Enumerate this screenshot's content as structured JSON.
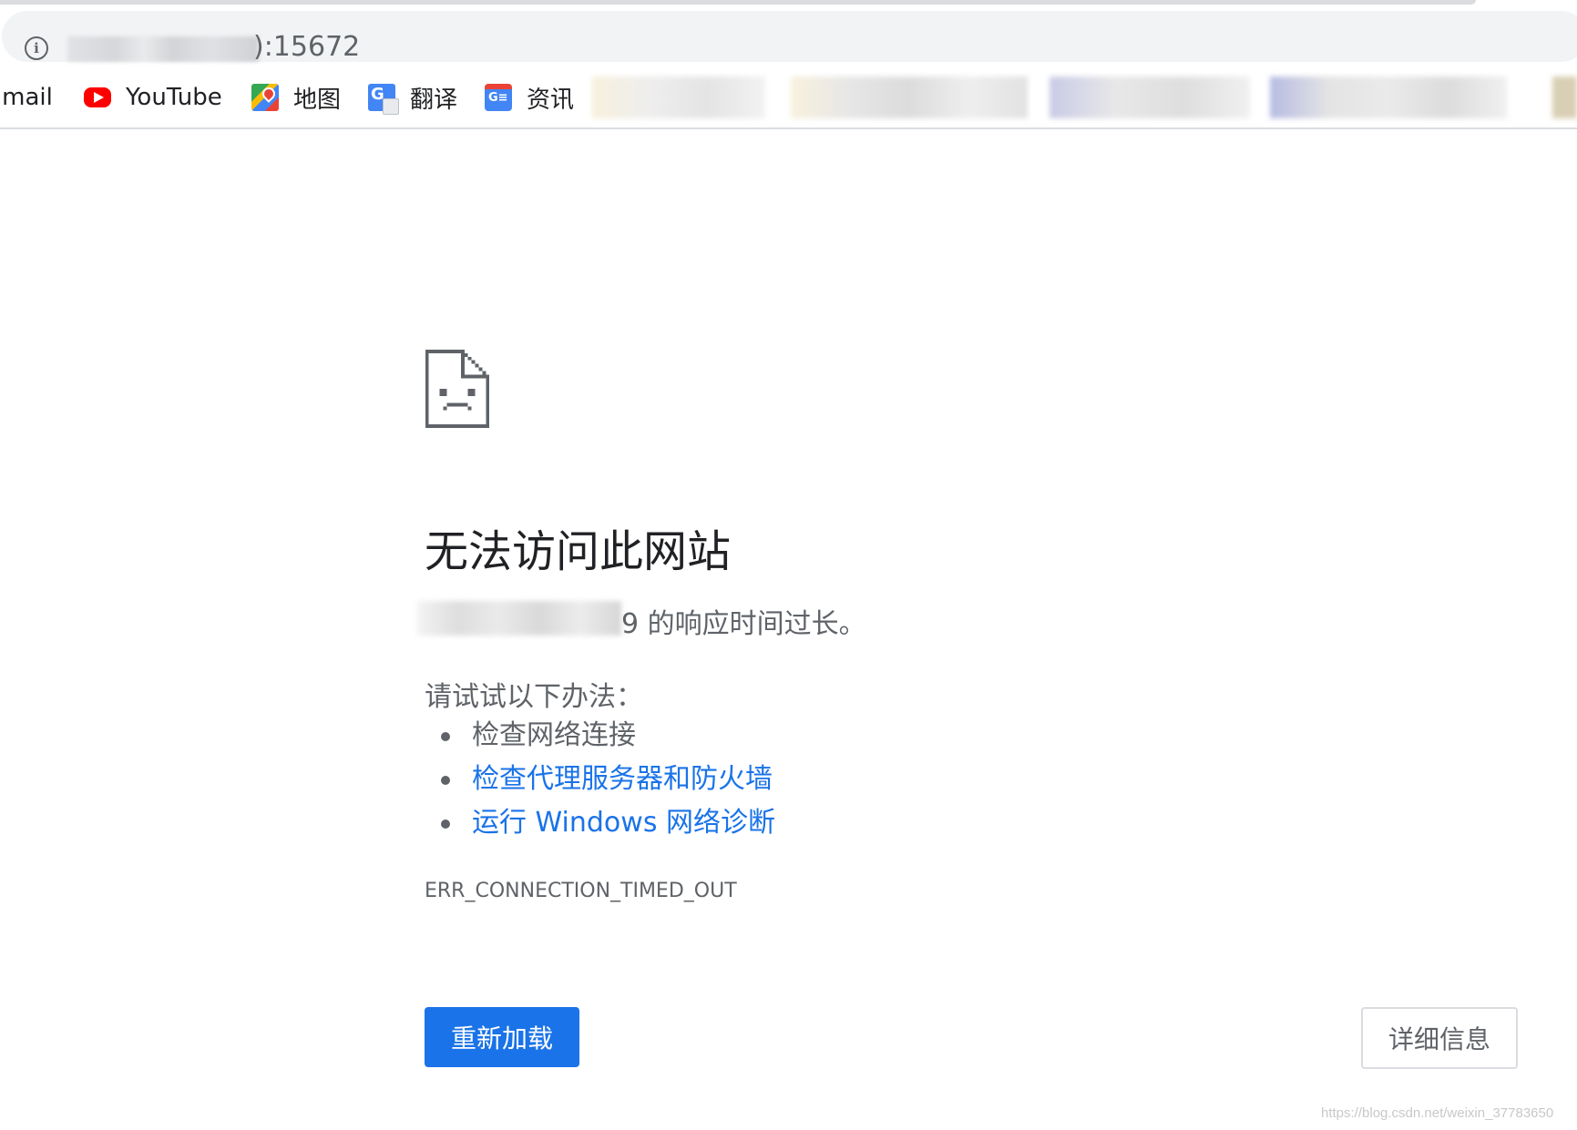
{
  "browser": {
    "address_bar": {
      "url_visible_suffix": "):15672"
    },
    "bookmarks": [
      {
        "label": "Gmail",
        "icon": "gmail-icon"
      },
      {
        "label": "YouTube",
        "icon": "youtube-icon"
      },
      {
        "label": "地图",
        "icon": "maps-icon"
      },
      {
        "label": "翻译",
        "icon": "translate-icon"
      },
      {
        "label": "资讯",
        "icon": "news-icon"
      }
    ]
  },
  "error_page": {
    "icon": "sad-document-icon",
    "title": "无法访问此网站",
    "response_message": "9 的响应时间过长。",
    "try_label": "请试试以下办法：",
    "suggestions": [
      {
        "text": "检查网络连接",
        "is_link": false
      },
      {
        "text": "检查代理服务器和防火墙",
        "is_link": true
      },
      {
        "text": "运行 Windows 网络诊断",
        "is_link": true
      }
    ],
    "error_code": "ERR_CONNECTION_TIMED_OUT",
    "buttons": {
      "reload": "重新加载",
      "details": "详细信息"
    }
  },
  "watermark": "https://blog.csdn.net/weixin_37783650",
  "colors": {
    "primary_blue": "#1a73e8",
    "text_dark": "#202124",
    "text_gray": "#5f6368",
    "youtube_red": "#ff0000"
  }
}
